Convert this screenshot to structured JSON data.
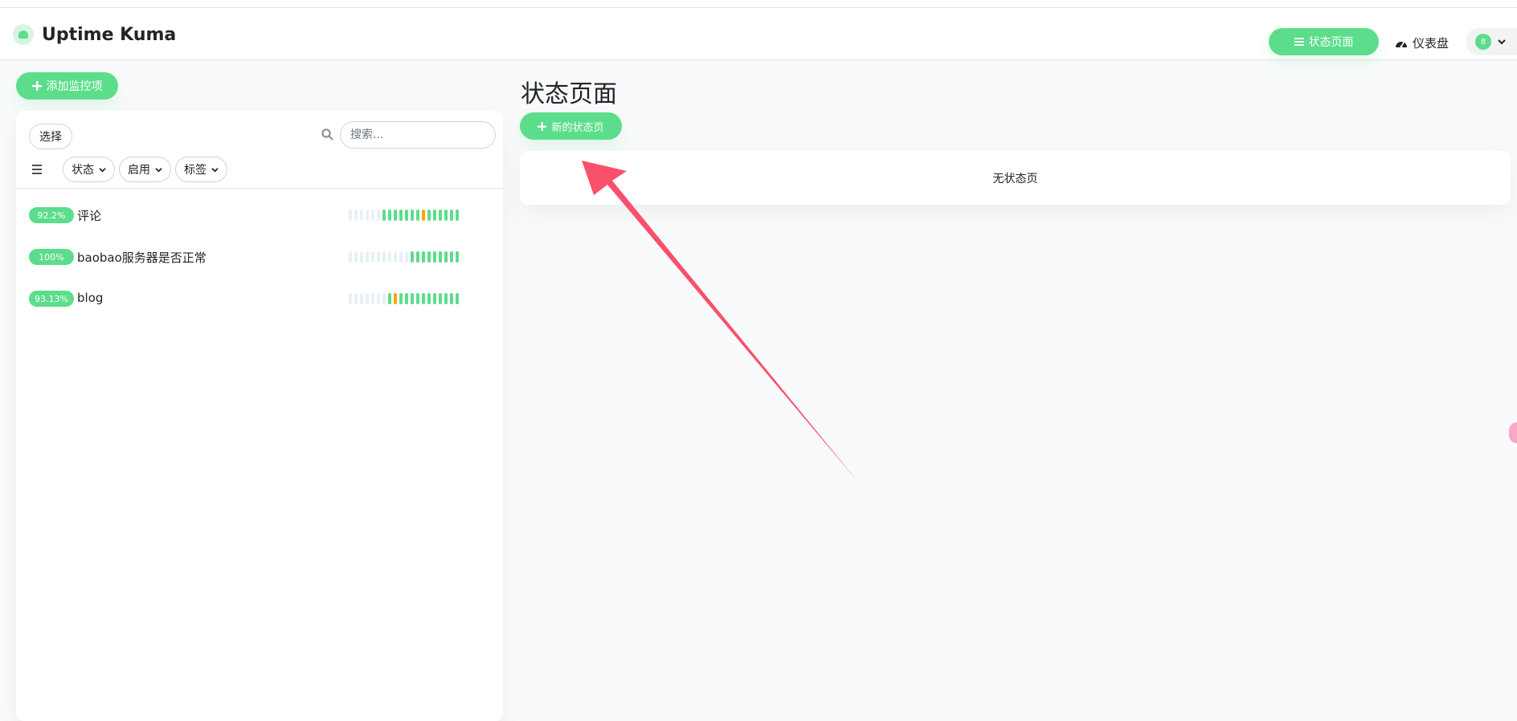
{
  "header": {
    "app_title": "Uptime Kuma",
    "status_page_label": "状态页面",
    "dashboard_label": "仪表盘",
    "avatar_text": "8"
  },
  "sidebar": {
    "add_monitor_label": "添加监控项",
    "select_label": "选择",
    "search_placeholder": "搜索...",
    "filters": {
      "status": "状态",
      "active": "启用",
      "tags": "标签"
    },
    "monitors": [
      {
        "uptime": "92.2%",
        "name": "评论"
      },
      {
        "uptime": "100%",
        "name": "baobao服务器是否正常"
      },
      {
        "uptime": "93.13%",
        "name": "blog"
      }
    ]
  },
  "main": {
    "title": "状态页面",
    "new_status_page_label": "新的状态页",
    "empty_text": "无状态页"
  },
  "colors": {
    "accent": "#5cdd8b",
    "warning": "#f8a306",
    "empty_beat": "#e8f1f6",
    "annotation_arrow": "#f9506b"
  },
  "icons": [
    "logo-icon",
    "list-icon",
    "gauge-icon",
    "search-icon",
    "plus-icon",
    "chevron-down-icon"
  ]
}
